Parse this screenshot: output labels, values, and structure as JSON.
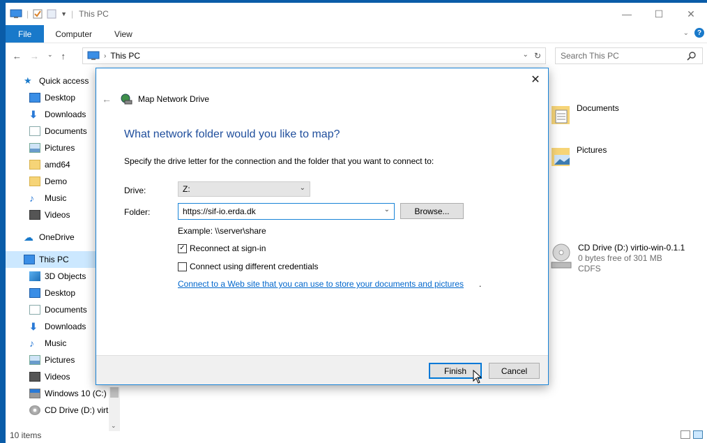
{
  "window": {
    "title": "This PC",
    "controls": {
      "minimize": "—",
      "maximize": "☐",
      "close": "✕"
    }
  },
  "ribbon": {
    "tabs": [
      "File",
      "Computer",
      "View"
    ]
  },
  "address": {
    "path_label": "This PC",
    "search_placeholder": "Search This PC"
  },
  "sidebar": {
    "items": [
      {
        "label": "Quick access",
        "icon": "star-icon"
      },
      {
        "label": "Desktop",
        "icon": "desktop-icon"
      },
      {
        "label": "Downloads",
        "icon": "download-icon"
      },
      {
        "label": "Documents",
        "icon": "document-icon"
      },
      {
        "label": "Pictures",
        "icon": "pictures-icon"
      },
      {
        "label": "amd64",
        "icon": "folder-icon"
      },
      {
        "label": "Demo",
        "icon": "folder-icon"
      },
      {
        "label": "Music",
        "icon": "music-icon"
      },
      {
        "label": "Videos",
        "icon": "videos-icon"
      },
      {
        "label": "OneDrive",
        "icon": "cloud-icon"
      },
      {
        "label": "This PC",
        "icon": "computer-icon"
      },
      {
        "label": "3D Objects",
        "icon": "cube-icon"
      },
      {
        "label": "Desktop",
        "icon": "desktop-icon"
      },
      {
        "label": "Documents",
        "icon": "document-icon"
      },
      {
        "label": "Downloads",
        "icon": "download-icon"
      },
      {
        "label": "Music",
        "icon": "music-icon"
      },
      {
        "label": "Pictures",
        "icon": "pictures-icon"
      },
      {
        "label": "Videos",
        "icon": "videos-icon"
      },
      {
        "label": "Windows 10 (C:)",
        "icon": "drive-icon"
      },
      {
        "label": "CD Drive (D:) virt",
        "icon": "cd-drive-icon"
      }
    ]
  },
  "content": {
    "documents": "Documents",
    "pictures": "Pictures",
    "cd_drive": {
      "name": "CD Drive (D:) virtio-win-0.1.1",
      "free": "0 bytes free of 301 MB",
      "fs": "CDFS"
    }
  },
  "status": {
    "count": "10 items"
  },
  "dialog": {
    "title": "Map Network Drive",
    "heading": "What network folder would you like to map?",
    "description": "Specify the drive letter for the connection and the folder that you want to connect to:",
    "drive_label": "Drive:",
    "drive_value": "Z:",
    "folder_label": "Folder:",
    "folder_value": "https://sif-io.erda.dk",
    "browse_label": "Browse...",
    "example": "Example: \\\\server\\share",
    "reconnect_label": "Reconnect at sign-in",
    "reconnect_checked": true,
    "credentials_label": "Connect using different credentials",
    "credentials_checked": false,
    "link": "Connect to a Web site that you can use to store your documents and pictures",
    "finish_label": "Finish",
    "cancel_label": "Cancel"
  },
  "colors": {
    "accent": "#1979ca",
    "heading": "#1f4e9c",
    "link": "#0066cc",
    "selection": "#cce8ff"
  }
}
